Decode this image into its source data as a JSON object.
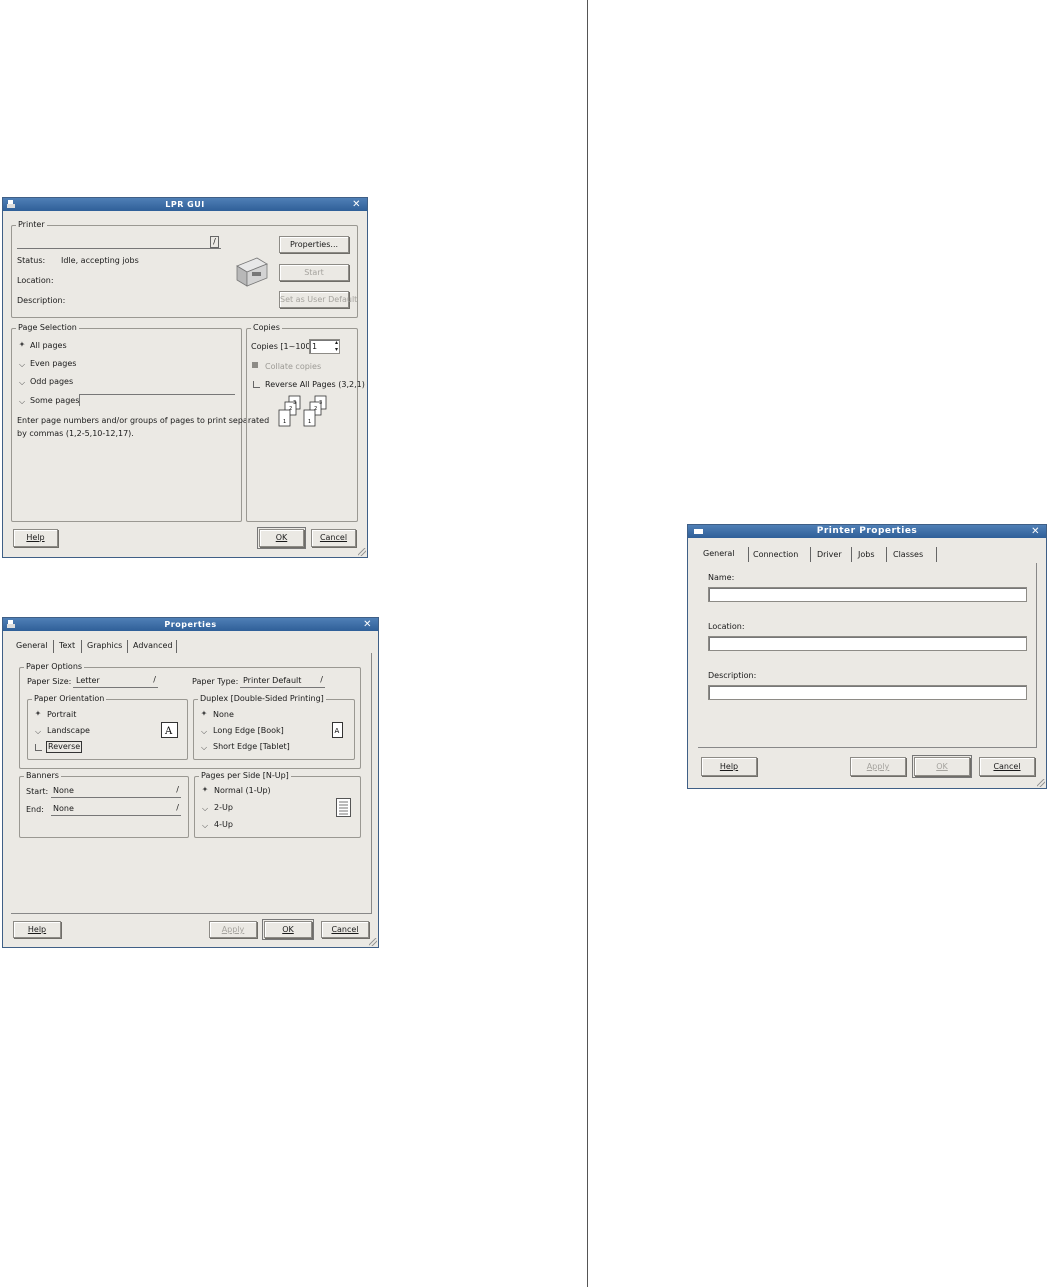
{
  "lpr": {
    "title": "LPR GUI",
    "printer_group": "Printer",
    "status_label": "Status:",
    "status_value": "Idle, accepting jobs",
    "location_label": "Location:",
    "description_label": "Description:",
    "properties_btn": "Properties...",
    "start_btn": "Start",
    "set_default_btn": "Set as User Default",
    "page_selection_group": "Page Selection",
    "all_pages": "All pages",
    "even_pages": "Even pages",
    "odd_pages": "Odd pages",
    "some_pages": "Some pages:",
    "hint_line1": "Enter page numbers and/or groups of pages to print separated",
    "hint_line2": "by commas (1,2-5,10-12,17).",
    "copies_group": "Copies",
    "copies_label": "Copies [1~100]:",
    "copies_value": "1",
    "collate": "Collate copies",
    "reverse_all": "Reverse All Pages (3,2,1)",
    "help_btn": "Help",
    "ok_btn": "OK",
    "cancel_btn": "Cancel"
  },
  "props": {
    "title": "Properties",
    "tabs": [
      "General",
      "Text",
      "Graphics",
      "Advanced"
    ],
    "paper_options_group": "Paper Options",
    "paper_size_label": "Paper Size:",
    "paper_size_value": "Letter",
    "paper_type_label": "Paper Type:",
    "paper_type_value": "Printer Default",
    "orientation_group": "Paper Orientation",
    "portrait": "Portrait",
    "landscape": "Landscape",
    "reverse": "Reverse",
    "duplex_group": "Duplex [Double-Sided Printing]",
    "duplex_none": "None",
    "long_edge": "Long Edge [Book]",
    "short_edge": "Short Edge [Tablet]",
    "banners_group": "Banners",
    "start_label": "Start:",
    "start_value": "None",
    "end_label": "End:",
    "end_value": "None",
    "nup_group": "Pages per Side [N-Up]",
    "normal": "Normal (1-Up)",
    "two_up": "2-Up",
    "four_up": "4-Up",
    "help_btn": "Help",
    "apply_btn": "Apply",
    "ok_btn": "OK",
    "cancel_btn": "Cancel"
  },
  "pp": {
    "title": "Printer Properties",
    "tabs": [
      "General",
      "Connection",
      "Driver",
      "Jobs",
      "Classes"
    ],
    "name_label": "Name:",
    "location_label": "Location:",
    "description_label": "Description:",
    "help_btn": "Help",
    "apply_btn": "Apply",
    "ok_btn": "OK",
    "cancel_btn": "Cancel"
  }
}
